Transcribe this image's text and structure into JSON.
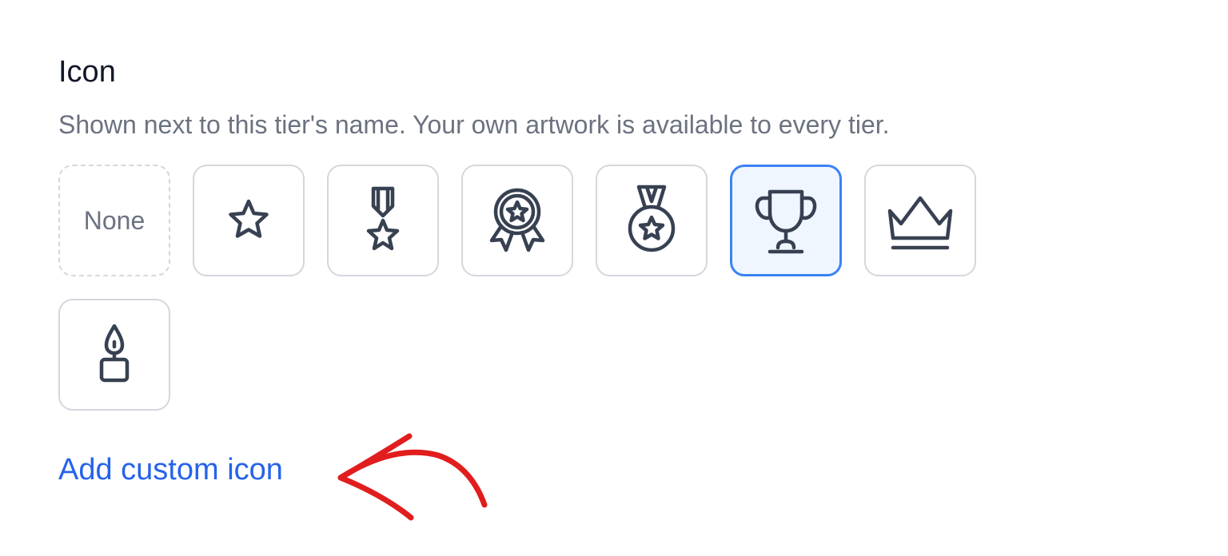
{
  "section": {
    "title": "Icon",
    "description": "Shown next to this tier's name. Your own artwork is available to every tier."
  },
  "icons": {
    "none_label": "None",
    "options": [
      "none",
      "star-icon",
      "medal-ribbon-icon",
      "award-rosette-icon",
      "medal-icon",
      "trophy-icon",
      "crown-icon",
      "candle-icon"
    ],
    "selected": "trophy-icon"
  },
  "actions": {
    "add_custom_icon": "Add custom icon"
  },
  "colors": {
    "accent": "#3b82f6",
    "link": "#2563eb",
    "annotation": "#e11d1d"
  }
}
